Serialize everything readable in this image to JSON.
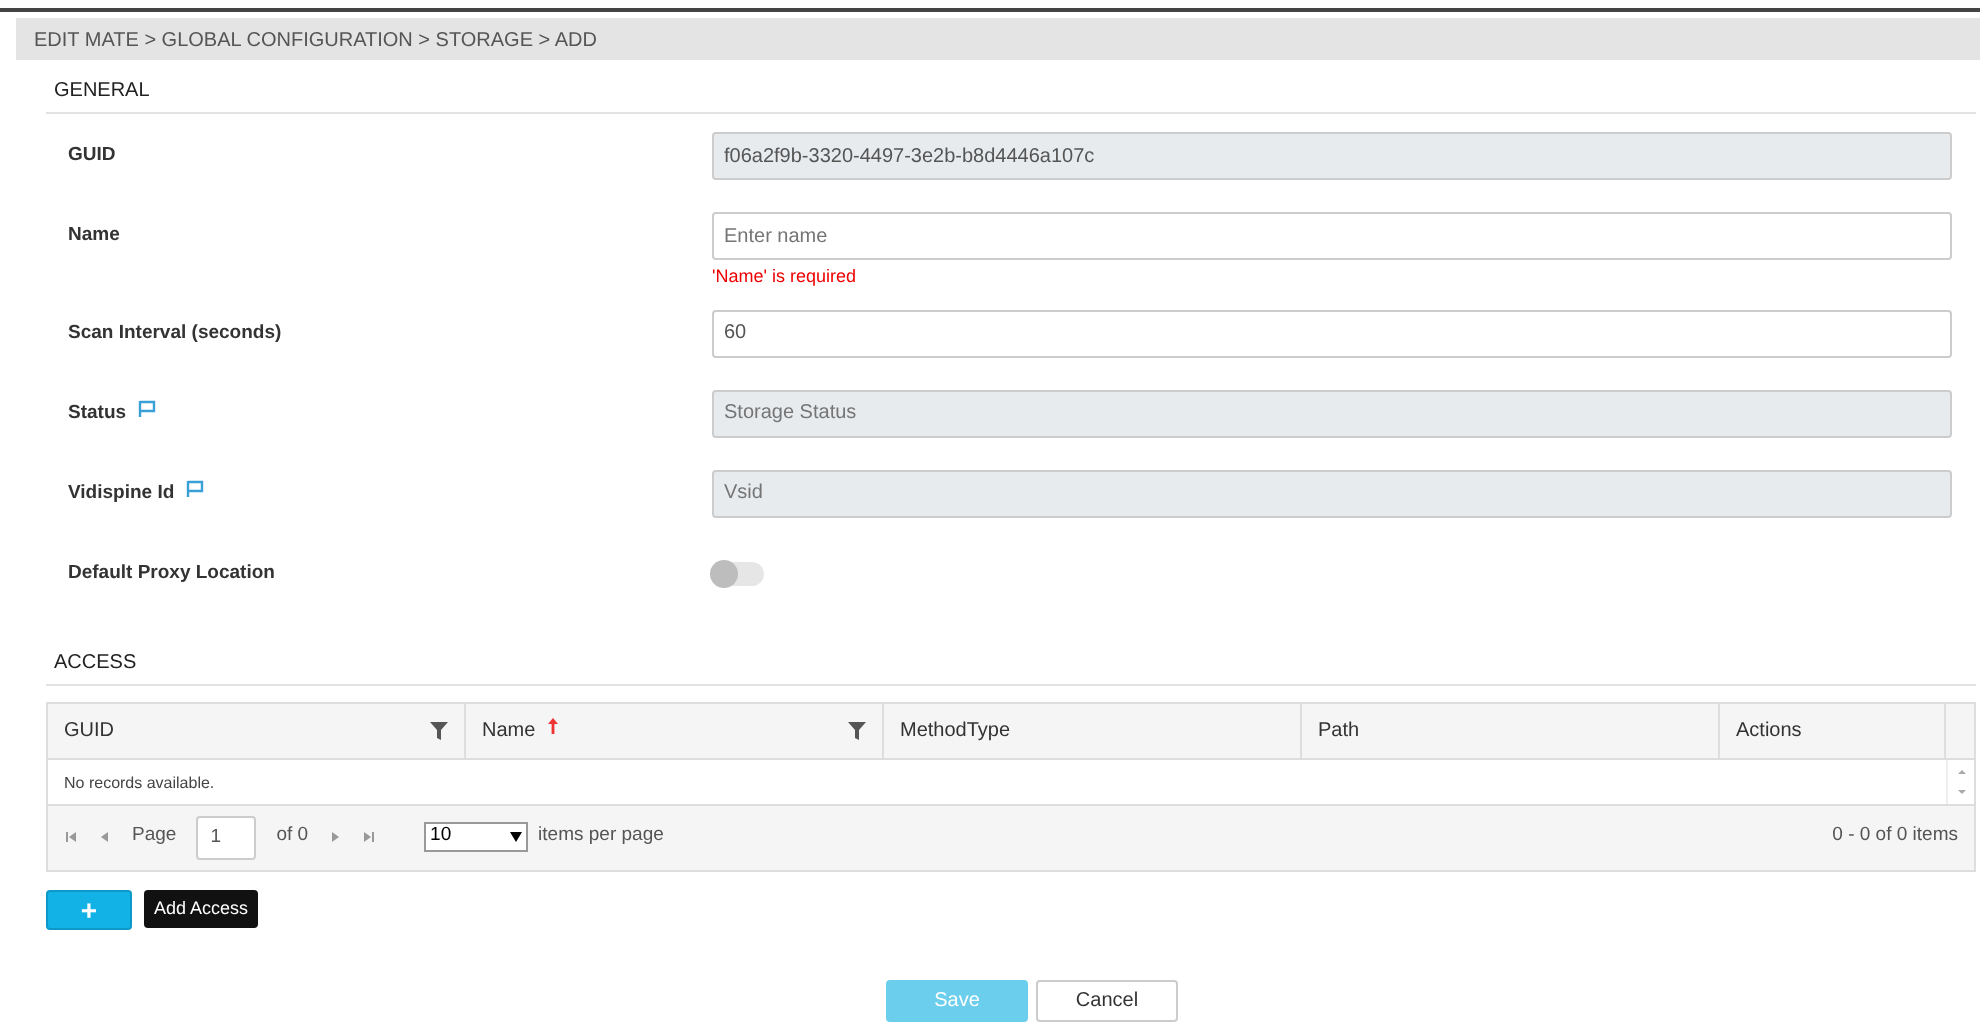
{
  "breadcrumb": "EDIT MATE > GLOBAL CONFIGURATION > STORAGE > ADD",
  "general": {
    "heading": "GENERAL",
    "fields": [
      {
        "kind": "text",
        "label": "GUID",
        "value": "f06a2f9b-3320-4497-3e2b-b8d4446a107c",
        "disabled": true,
        "info_flag": false
      },
      {
        "kind": "text",
        "label": "Name",
        "placeholder": "Enter name",
        "error": "'Name' is required",
        "disabled": false,
        "info_flag": false
      },
      {
        "kind": "text",
        "label": "Scan Interval (seconds)",
        "value": "60",
        "disabled": false,
        "info_flag": false
      },
      {
        "kind": "text",
        "label": "Status",
        "placeholder": "Storage Status",
        "disabled": true,
        "info_flag": true
      },
      {
        "kind": "text",
        "label": "Vidispine Id",
        "placeholder": "Vsid",
        "disabled": true,
        "info_flag": true
      },
      {
        "kind": "toggle",
        "label": "Default Proxy Location",
        "on": false
      }
    ]
  },
  "access": {
    "heading": "ACCESS",
    "table": {
      "columns": [
        {
          "label": "GUID",
          "filter": true,
          "sorted": false
        },
        {
          "label": "Name",
          "filter": true,
          "sorted": true
        },
        {
          "label": "MethodType",
          "filter": false,
          "sorted": false
        },
        {
          "label": "Path",
          "filter": false,
          "sorted": false
        },
        {
          "label": "Actions",
          "filter": false,
          "sorted": false
        }
      ],
      "empty_message": "No records available.",
      "pager": {
        "page_label": "Page",
        "page": "1",
        "of": "of 0",
        "page_size": "10",
        "per_page_label": "items per page",
        "summary": "0 - 0 of 0 items"
      }
    },
    "add_button": {
      "label": "+",
      "tooltip": "Add Access"
    }
  },
  "buttons": [
    {
      "label": "Save",
      "kind": "primary",
      "disabled": true
    },
    {
      "label": "Cancel",
      "kind": "secondary",
      "disabled": false
    }
  ]
}
